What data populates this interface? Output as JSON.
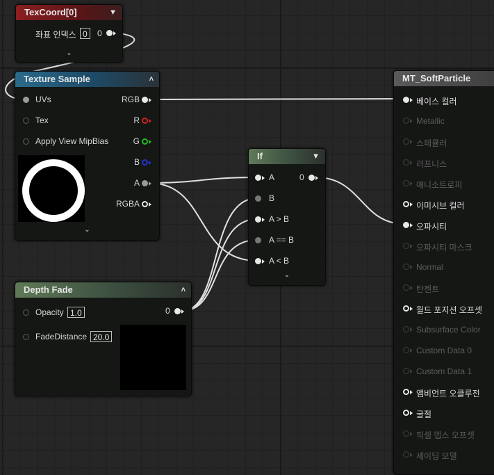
{
  "texcoord": {
    "title": "TexCoord[0]",
    "index_label": "좌표 인덱스",
    "index_value": "0",
    "output_label": "0"
  },
  "texture_sample": {
    "title": "Texture Sample",
    "inputs": [
      "UVs",
      "Tex",
      "Apply View MipBias"
    ],
    "outputs": [
      "RGB",
      "R",
      "G",
      "B",
      "A",
      "RGBA"
    ],
    "output_colors": {
      "R": "#cc2222",
      "G": "#22bb22",
      "B": "#2233cc"
    }
  },
  "if_node": {
    "title": "If",
    "inputs": [
      "A",
      "B",
      "A > B",
      "A == B",
      "A < B"
    ],
    "output_label": "0"
  },
  "depth_fade": {
    "title": "Depth Fade",
    "opacity_label": "Opacity",
    "opacity_value": "1.0",
    "fade_label": "FadeDistance",
    "fade_value": "20.0",
    "output_label": "0"
  },
  "material": {
    "title": "MT_SoftParticle",
    "pins": [
      {
        "label": "베이스 컬러",
        "active": true
      },
      {
        "label": "Metallic",
        "active": false
      },
      {
        "label": "스페큘러",
        "active": false
      },
      {
        "label": "러프니스",
        "active": false
      },
      {
        "label": "애니소트로피",
        "active": false
      },
      {
        "label": "이미시브 컬러",
        "active": true
      },
      {
        "label": "오파시티",
        "active": true
      },
      {
        "label": "오파시티 마스크",
        "active": false
      },
      {
        "label": "Normal",
        "active": false
      },
      {
        "label": "탄젠트",
        "active": false
      },
      {
        "label": "월드 포지션 오프셋",
        "active": true
      },
      {
        "label": "Subsurface Color",
        "active": false
      },
      {
        "label": "Custom Data 0",
        "active": false
      },
      {
        "label": "Custom Data 1",
        "active": false
      },
      {
        "label": "앰비언트 오클루전",
        "active": true
      },
      {
        "label": "굴절",
        "active": true
      },
      {
        "label": "픽셀 뎁스 오프셋",
        "active": false
      },
      {
        "label": "셰이딩 모델",
        "active": false
      }
    ]
  }
}
